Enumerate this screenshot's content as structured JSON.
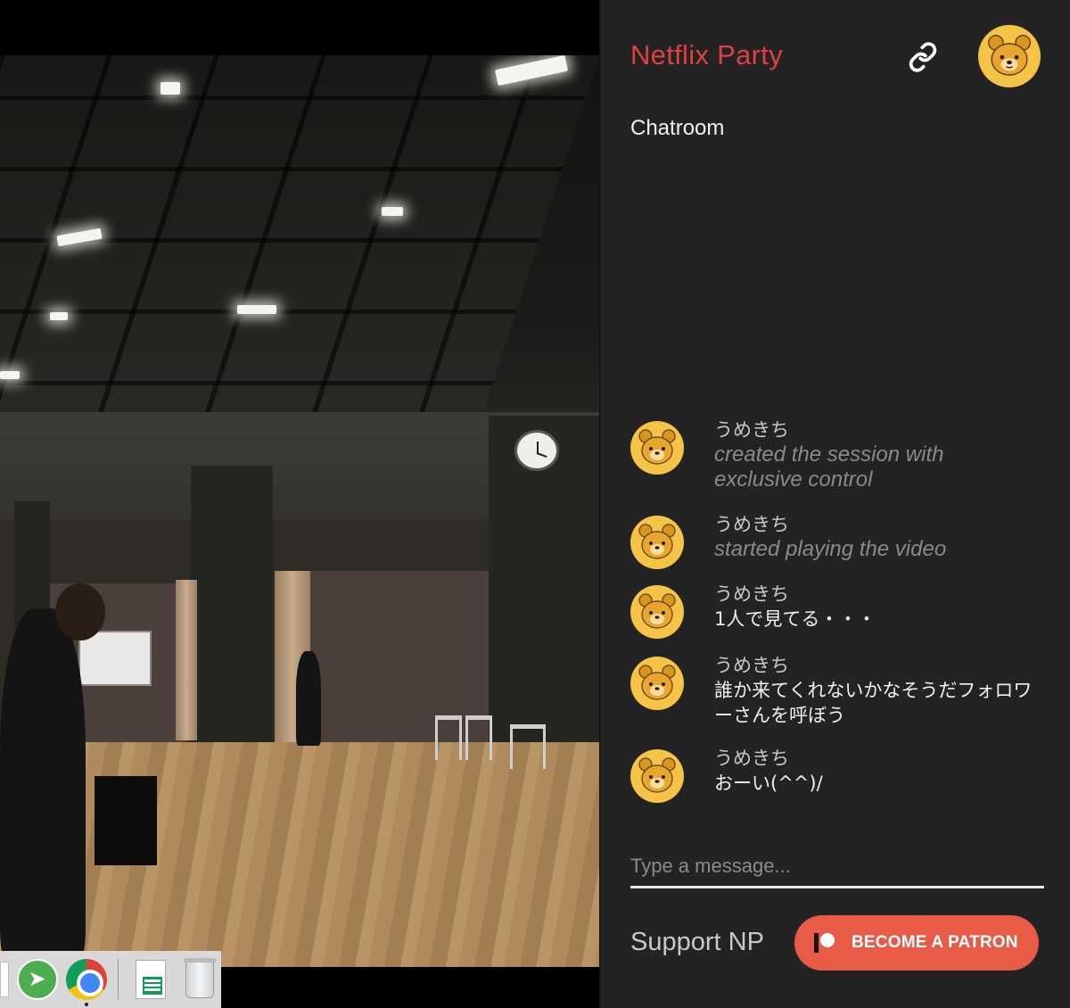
{
  "app": {
    "brand": "Netflix Party"
  },
  "header": {
    "link_icon": "link-icon",
    "avatar_icon": "bear-avatar-icon"
  },
  "chat": {
    "title": "Chatroom",
    "messages": [
      {
        "user": "うめきち",
        "text": "created the session with exclusive control",
        "system": true
      },
      {
        "user": "うめきち",
        "text": "started playing the video",
        "system": true
      },
      {
        "user": "うめきち",
        "text": "1人で見てる・・・",
        "system": false
      },
      {
        "user": "うめきち",
        "text": "誰か来てくれないかなそうだフォロワーさんを呼ぼう",
        "system": false
      },
      {
        "user": "うめきち",
        "text": "おーい(^^)/",
        "system": false
      }
    ],
    "input_placeholder": "Type a message..."
  },
  "footer": {
    "support_label": "Support NP",
    "patron_button": "BECOME A PATRON"
  },
  "taskbar": {
    "icons": [
      "document-icon",
      "telegram-icon",
      "chrome-icon",
      "sheets-icon",
      "trash-icon"
    ]
  },
  "colors": {
    "brand": "#e04040",
    "sidebar_bg": "#232323",
    "patron_button": "#e85b46",
    "avatar": "#f5c447"
  }
}
